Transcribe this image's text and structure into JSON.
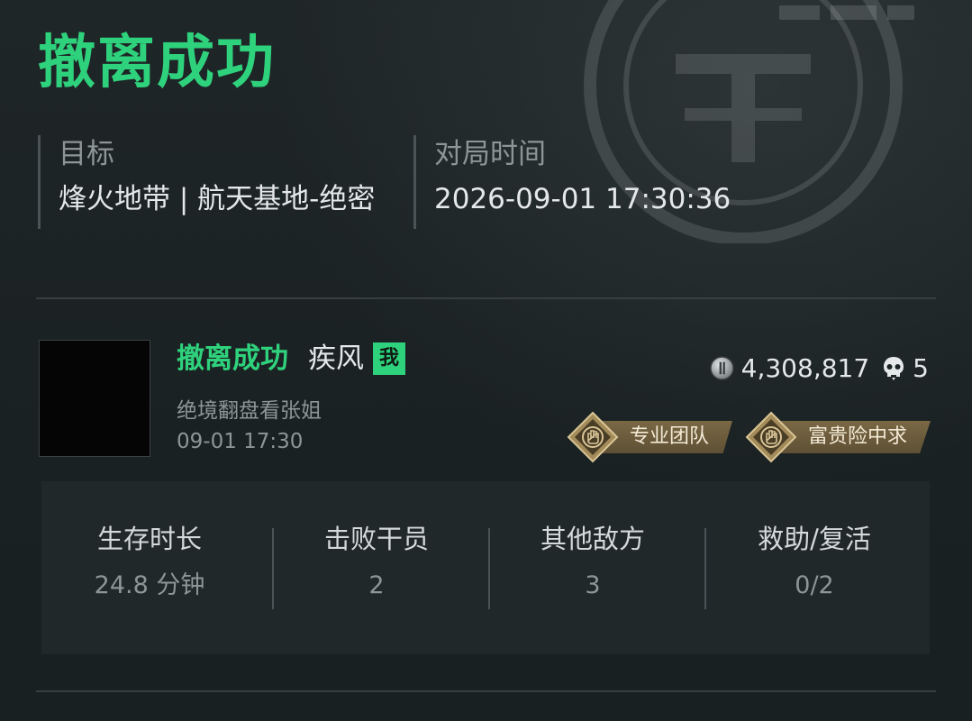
{
  "header": {
    "title": "撤离成功"
  },
  "match_info": {
    "target_label": "目标",
    "target_value": "烽火地带 | 航天基地-绝密",
    "time_label": "对局时间",
    "time_value": "2026-09-01 17:30:36"
  },
  "player": {
    "status": "撤离成功",
    "name": "疾风",
    "me_badge": "我",
    "team": "绝境翻盘看张姐",
    "time": "09-01 17:30",
    "coins": "4,308,817",
    "kills": "5",
    "badges": [
      {
        "label": "专业团队",
        "icon": "hand-emblem-icon"
      },
      {
        "label": "富贵险中求",
        "icon": "hand-emblem-icon"
      }
    ]
  },
  "stats": [
    {
      "label": "生存时长",
      "value": "24.8 分钟"
    },
    {
      "label": "击败干员",
      "value": "2"
    },
    {
      "label": "其他敌方",
      "value": "3"
    },
    {
      "label": "救助/复活",
      "value": "0/2"
    }
  ],
  "colors": {
    "accent_green": "#2fd27c",
    "background": "#1b2224",
    "badge_gold": "#7a6845"
  }
}
